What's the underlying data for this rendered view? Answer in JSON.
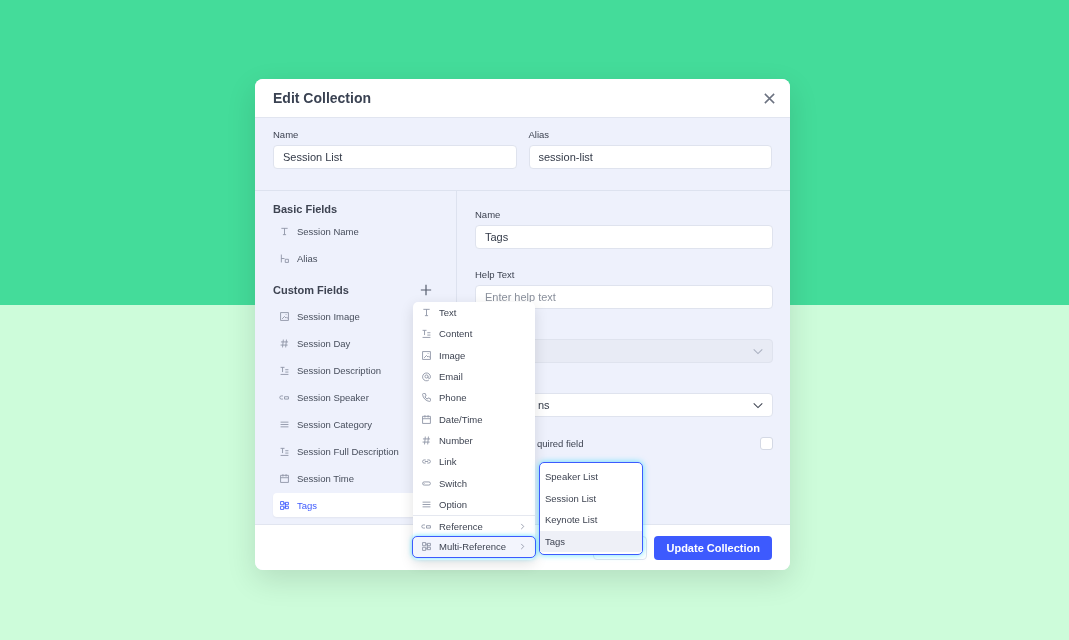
{
  "dialog": {
    "title": "Edit Collection"
  },
  "collection": {
    "name_label": "Name",
    "name_value": "Session List",
    "alias_label": "Alias",
    "alias_value": "session-list"
  },
  "basic_fields": {
    "heading": "Basic Fields",
    "items": [
      {
        "label": "Session Name",
        "kind": "text",
        "selected": false
      },
      {
        "label": "Alias",
        "kind": "alias",
        "selected": false
      }
    ]
  },
  "custom_fields": {
    "heading": "Custom Fields",
    "items": [
      {
        "label": "Session Image",
        "kind": "image",
        "selected": false
      },
      {
        "label": "Session Day",
        "kind": "number",
        "selected": false
      },
      {
        "label": "Session Description",
        "kind": "content",
        "selected": false
      },
      {
        "label": "Session Speaker",
        "kind": "reference",
        "selected": false
      },
      {
        "label": "Session Category",
        "kind": "option",
        "selected": false
      },
      {
        "label": "Session Full Description",
        "kind": "content",
        "selected": false
      },
      {
        "label": "Session Time",
        "kind": "date",
        "selected": false
      },
      {
        "label": "Tags",
        "kind": "multi",
        "selected": true
      }
    ]
  },
  "field_editor": {
    "name_label": "Name",
    "name_value": "Tags",
    "help_label": "Help Text",
    "help_placeholder": "Enter help text",
    "type_select_disabled": true,
    "select_value": "ns",
    "required_label": "quired field",
    "required_checked": false
  },
  "type_menu": [
    {
      "label": "Text",
      "kind": "text",
      "has_submenu": false,
      "selected": false
    },
    {
      "label": "Content",
      "kind": "content",
      "has_submenu": false,
      "selected": false
    },
    {
      "label": "Image",
      "kind": "image",
      "has_submenu": false,
      "selected": false
    },
    {
      "label": "Email",
      "kind": "email",
      "has_submenu": false,
      "selected": false
    },
    {
      "label": "Phone",
      "kind": "phone",
      "has_submenu": false,
      "selected": false
    },
    {
      "label": "Date/Time",
      "kind": "date",
      "has_submenu": false,
      "selected": false
    },
    {
      "label": "Number",
      "kind": "number",
      "has_submenu": false,
      "selected": false
    },
    {
      "label": "Link",
      "kind": "link",
      "has_submenu": false,
      "selected": false
    },
    {
      "label": "Switch",
      "kind": "switch",
      "has_submenu": false,
      "selected": false
    },
    {
      "label": "Option",
      "kind": "option",
      "has_submenu": false,
      "selected": false
    },
    {
      "label": "Reference",
      "kind": "reference",
      "has_submenu": true,
      "selected": false
    },
    {
      "label": "Multi-Reference",
      "kind": "multi",
      "has_submenu": true,
      "selected": true
    }
  ],
  "reference_submenu": [
    {
      "label": "Speaker List",
      "selected": false
    },
    {
      "label": "Session List",
      "selected": false
    },
    {
      "label": "Keynote List",
      "selected": false
    },
    {
      "label": "Tags",
      "selected": true
    }
  ],
  "footer": {
    "primary_button": "Update Collection"
  }
}
